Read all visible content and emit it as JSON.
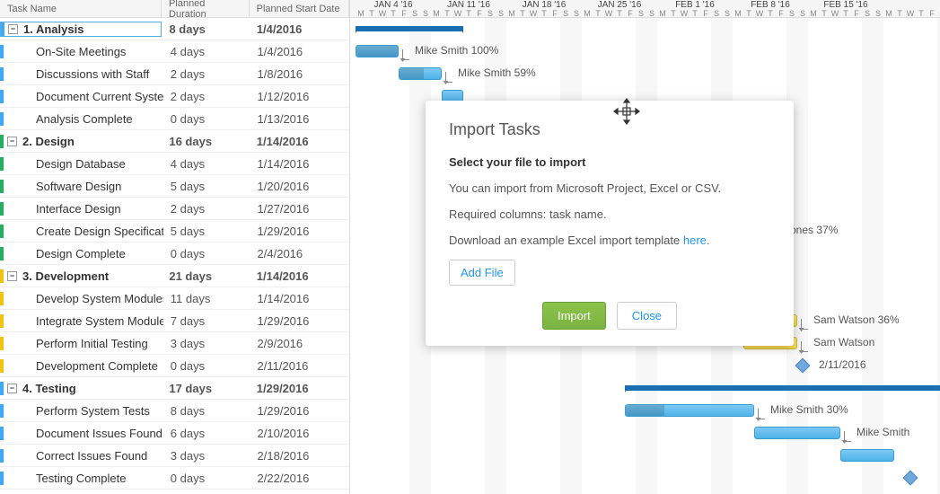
{
  "columns": {
    "name": "Task Name",
    "duration": "Planned Duration",
    "start": "Planned Start Date"
  },
  "weeks": [
    "JAN 4 '16",
    "JAN 11 '16",
    "JAN 18 '16",
    "JAN 25 '16",
    "FEB 1 '16",
    "FEB 8 '16",
    "FEB 15 '16"
  ],
  "days": [
    "M",
    "T",
    "W",
    "T",
    "F",
    "S",
    "S"
  ],
  "tasks": [
    {
      "name": "1. Analysis",
      "duration": "8 days",
      "start": "1/4/2016",
      "summary": true,
      "color": "#3fa9f5"
    },
    {
      "name": "On-Site Meetings",
      "duration": "4 days",
      "start": "1/4/2016",
      "color": "#3fa9f5"
    },
    {
      "name": "Discussions with Staff",
      "duration": "2 days",
      "start": "1/8/2016",
      "color": "#3fa9f5"
    },
    {
      "name": "Document Current Systems",
      "duration": "2 days",
      "start": "1/12/2016",
      "color": "#3fa9f5"
    },
    {
      "name": "Analysis Complete",
      "duration": "0 days",
      "start": "1/13/2016",
      "color": "#3fa9f5"
    },
    {
      "name": "2. Design",
      "duration": "16 days",
      "start": "1/14/2016",
      "summary": true,
      "color": "#27ae60"
    },
    {
      "name": "Design Database",
      "duration": "4 days",
      "start": "1/14/2016",
      "color": "#27ae60"
    },
    {
      "name": "Software Design",
      "duration": "5 days",
      "start": "1/20/2016",
      "color": "#27ae60"
    },
    {
      "name": "Interface Design",
      "duration": "2 days",
      "start": "1/27/2016",
      "color": "#27ae60"
    },
    {
      "name": "Create Design Specification",
      "duration": "5 days",
      "start": "1/29/2016",
      "color": "#27ae60"
    },
    {
      "name": "Design Complete",
      "duration": "0 days",
      "start": "2/4/2016",
      "color": "#27ae60"
    },
    {
      "name": "3. Development",
      "duration": "21 days",
      "start": "1/14/2016",
      "summary": true,
      "color": "#f1c40f"
    },
    {
      "name": "Develop System Modules",
      "duration": "11 days",
      "start": "1/14/2016",
      "color": "#f1c40f"
    },
    {
      "name": "Integrate System Modules",
      "duration": "7 days",
      "start": "1/29/2016",
      "color": "#f1c40f"
    },
    {
      "name": "Perform Initial Testing",
      "duration": "3 days",
      "start": "2/9/2016",
      "color": "#f1c40f"
    },
    {
      "name": "Development Complete",
      "duration": "0 days",
      "start": "2/11/2016",
      "color": "#f1c40f"
    },
    {
      "name": "4. Testing",
      "duration": "17 days",
      "start": "1/29/2016",
      "summary": true,
      "color": "#3fa9f5"
    },
    {
      "name": "Perform System Tests",
      "duration": "8 days",
      "start": "1/29/2016",
      "color": "#3fa9f5"
    },
    {
      "name": "Document Issues Found",
      "duration": "6 days",
      "start": "2/10/2016",
      "color": "#3fa9f5"
    },
    {
      "name": "Correct Issues Found",
      "duration": "3 days",
      "start": "2/18/2016",
      "color": "#3fa9f5"
    },
    {
      "name": "Testing Complete",
      "duration": "0 days",
      "start": "2/22/2016",
      "color": "#3fa9f5"
    }
  ],
  "gantt_labels": {
    "row1": "Mike Smith  100%",
    "row2": "Mike Smith  59%",
    "row9": "ones  37%",
    "row13": "Sam Watson  36%",
    "row14": "Sam Watson",
    "row15": "2/11/2016",
    "row17": "Mike Smith  30%",
    "row18": "Mike Smith"
  },
  "dialog": {
    "title": "Import Tasks",
    "subtitle": "Select your file to import",
    "line1": "You can import from Microsoft Project, Excel or CSV.",
    "line2": "Required columns: task name.",
    "line3a": "Download an example Excel import template ",
    "line3b": "here",
    "line3c": ".",
    "add_file": "Add File",
    "import_btn": "Import",
    "close_btn": "Close"
  }
}
